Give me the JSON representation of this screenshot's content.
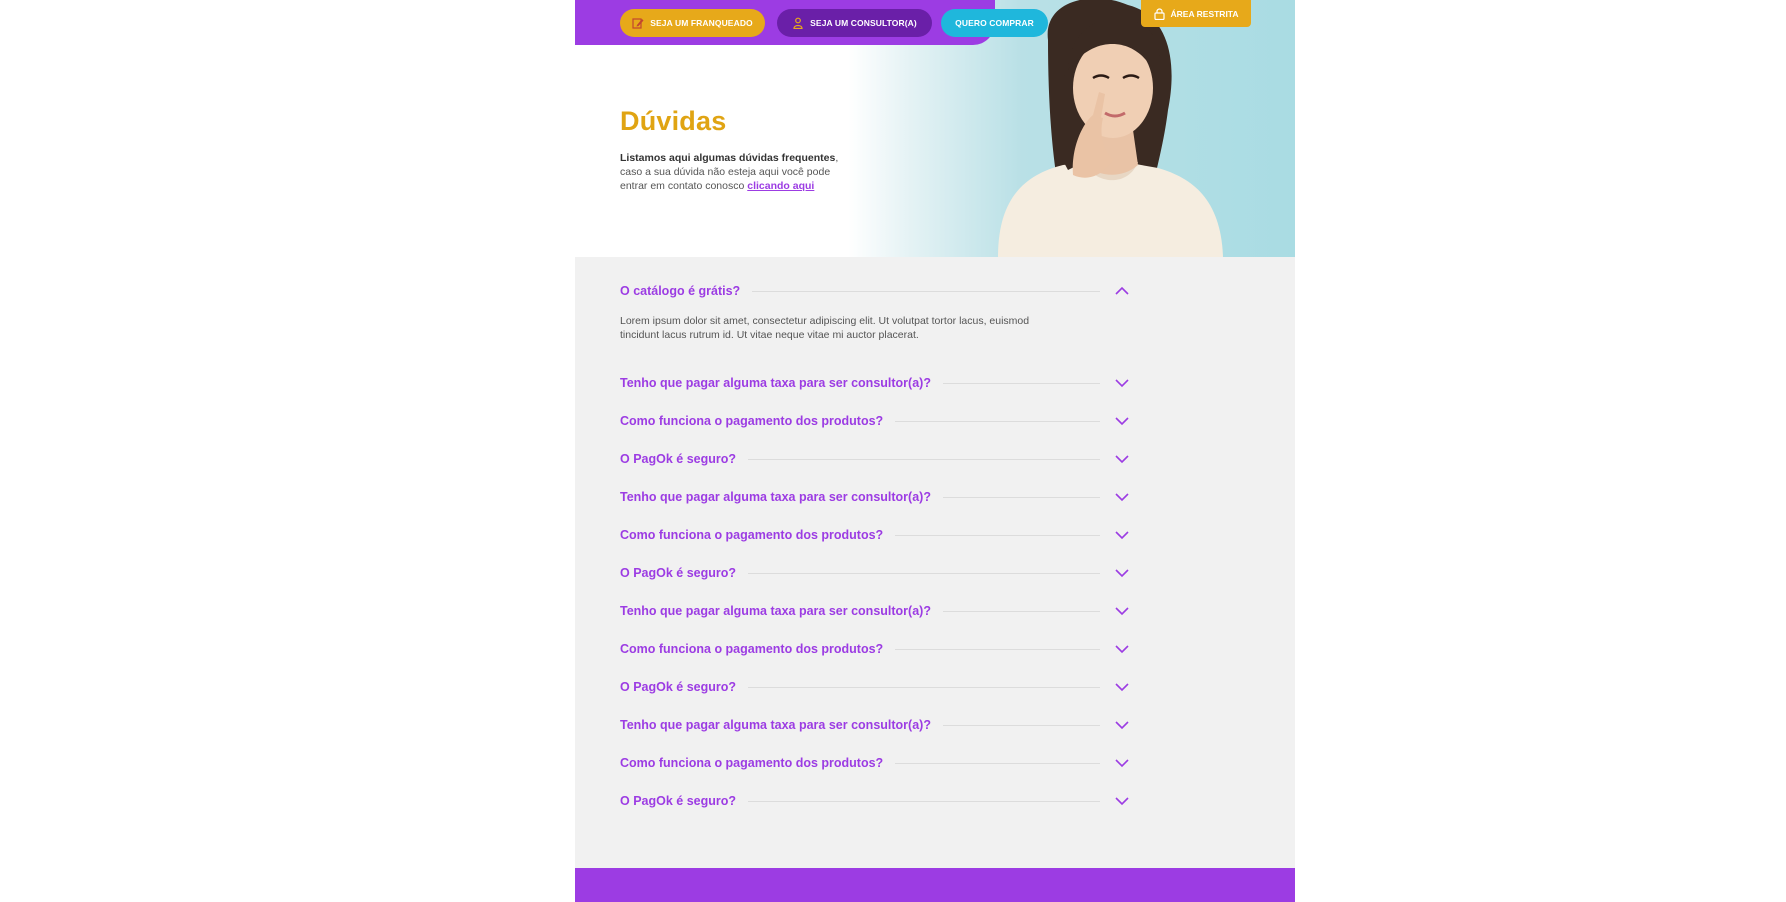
{
  "header": {
    "franqueado_label": "SEJA UM FRANQUEADO",
    "consultor_label": "SEJA UM CONSULTOR(A)",
    "comprar_label": "QUERO COMPRAR",
    "restrita_label": "ÁREA RESTRITA"
  },
  "hero": {
    "title": "Dúvidas",
    "intro_bold": "Listamos aqui algumas dúvidas frequentes",
    "intro_rest": ", caso a sua dúvida não esteja aqui você pode entrar em contato conosco ",
    "link": "clicando aqui"
  },
  "faq": {
    "items": [
      {
        "question": "O catálogo é grátis?",
        "expanded": true,
        "answer": "Lorem ipsum dolor sit amet, consectetur adipiscing elit. Ut volutpat tortor lacus, euismod tincidunt lacus rutrum id. Ut vitae neque vitae mi auctor placerat."
      },
      {
        "question": "Tenho que pagar alguma taxa para ser consultor(a)?",
        "expanded": false
      },
      {
        "question": "Como funciona o pagamento dos produtos?",
        "expanded": false
      },
      {
        "question": "O PagOk é seguro?",
        "expanded": false
      },
      {
        "question": "Tenho que pagar alguma taxa para ser consultor(a)?",
        "expanded": false
      },
      {
        "question": "Como funciona o pagamento dos produtos?",
        "expanded": false
      },
      {
        "question": "O PagOk é seguro?",
        "expanded": false
      },
      {
        "question": "Tenho que pagar alguma taxa para ser consultor(a)?",
        "expanded": false
      },
      {
        "question": "Como funciona o pagamento dos produtos?",
        "expanded": false
      },
      {
        "question": "O PagOk é seguro?",
        "expanded": false
      },
      {
        "question": "Tenho que pagar alguma taxa para ser consultor(a)?",
        "expanded": false
      },
      {
        "question": "Como funciona o pagamento dos produtos?",
        "expanded": false
      },
      {
        "question": "O PagOk é seguro?",
        "expanded": false
      }
    ]
  },
  "icons": {
    "franqueado": "edit-icon",
    "consultor": "person-icon",
    "restrita": "lock-icon",
    "expanded": "chevron-up-icon",
    "collapsed": "chevron-down-icon"
  },
  "colors": {
    "purple": "#9c3ce3",
    "dark_purple": "#6a1fa8",
    "gold": "#e7a91a",
    "cyan": "#1fb7dc",
    "background": "#f1f1f1"
  }
}
